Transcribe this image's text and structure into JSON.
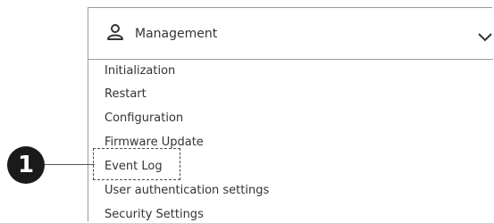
{
  "header": {
    "icon": "user-icon",
    "title": "Management",
    "toggle_icon": "chevron-down-icon"
  },
  "menu": {
    "items": [
      "Initialization",
      "Restart",
      "Configuration",
      "Firmware Update",
      "Event Log",
      "User authentication settings",
      "Security Settings"
    ]
  },
  "callout": {
    "number": "1",
    "target": "Event Log"
  },
  "colors": {
    "text": "#333333",
    "border": "#9a9a9a",
    "badge": "#1a1a1a"
  }
}
